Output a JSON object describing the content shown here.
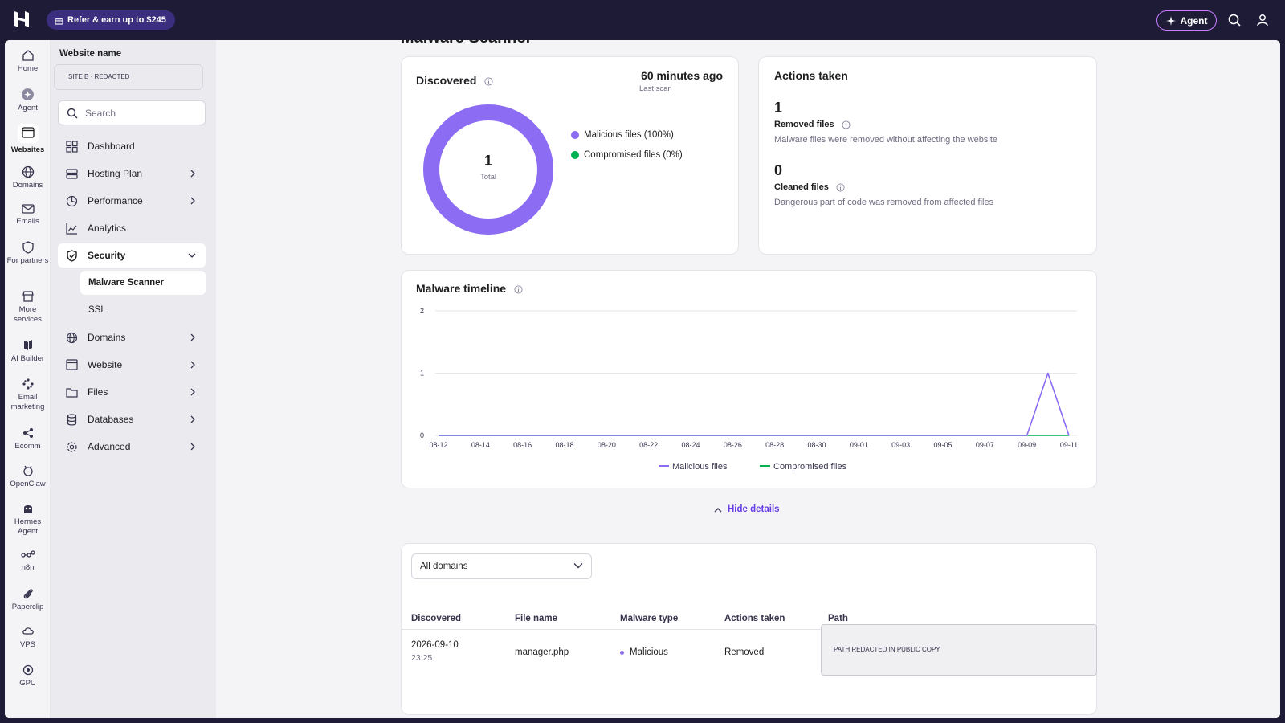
{
  "topbar": {
    "refer_label": "Refer & earn up to $245",
    "agent_label": "Agent",
    "accent": "#673de6"
  },
  "rail": {
    "items": [
      {
        "label": "Home",
        "icon": "home-icon"
      },
      {
        "label": "Agent",
        "icon": "agent-icon"
      },
      {
        "label": "Websites",
        "icon": "websites-icon"
      },
      {
        "label": "Domains",
        "icon": "globe-icon"
      },
      {
        "label": "Emails",
        "icon": "mail-icon"
      },
      {
        "label": "For partners",
        "icon": "shield-icon"
      },
      {
        "label": "More services",
        "icon": "store-icon"
      },
      {
        "label": "AI Builder",
        "icon": "ai-builder-icon"
      },
      {
        "label": "Email marketing",
        "icon": "email-marketing-icon"
      },
      {
        "label": "Ecomm",
        "icon": "ecomm-icon"
      },
      {
        "label": "OpenClaw",
        "icon": "openclaw-icon"
      },
      {
        "label": "Hermes Agent",
        "icon": "hermes-icon"
      },
      {
        "label": "n8n",
        "icon": "n8n-icon"
      },
      {
        "label": "Paperclip",
        "icon": "paperclip-icon"
      },
      {
        "label": "VPS",
        "icon": "vps-icon"
      },
      {
        "label": "GPU",
        "icon": "gpu-icon"
      }
    ]
  },
  "sidebar": {
    "title": "Website name",
    "site": "SITE B · REDACTED",
    "search_placeholder": "Search",
    "items": [
      {
        "label": "Dashboard"
      },
      {
        "label": "Hosting Plan"
      },
      {
        "label": "Performance"
      },
      {
        "label": "Analytics"
      },
      {
        "label": "Security"
      },
      {
        "label": "Domains"
      },
      {
        "label": "Website"
      },
      {
        "label": "Files"
      },
      {
        "label": "Databases"
      },
      {
        "label": "Advanced"
      }
    ],
    "security_sub": [
      {
        "label": "Malware Scanner"
      },
      {
        "label": "SSL"
      }
    ]
  },
  "page": {
    "title": "Malware Scanner"
  },
  "discovered": {
    "title": "Discovered",
    "last_scan_time": "60 minutes ago",
    "last_scan_label": "Last scan",
    "total": "1",
    "total_label": "Total",
    "legend": [
      {
        "label": "Malicious files (100%)",
        "color": "#8c6cf2"
      },
      {
        "label": "Compromised files (0%)",
        "color": "#00b14f"
      }
    ]
  },
  "actions": {
    "title": "Actions taken",
    "removed_count": "1",
    "removed_label": "Removed files",
    "removed_desc": "Malware files were removed without affecting the website",
    "cleaned_count": "0",
    "cleaned_label": "Cleaned files",
    "cleaned_desc": "Dangerous part of code was removed from affected files"
  },
  "timeline": {
    "title": "Malware timeline",
    "hide_details": "Hide details"
  },
  "chart_data": {
    "type": "line",
    "title": "Malware timeline",
    "x": [
      "08-12",
      "08-13",
      "08-14",
      "08-15",
      "08-16",
      "08-17",
      "08-18",
      "08-19",
      "08-20",
      "08-21",
      "08-22",
      "08-23",
      "08-24",
      "08-25",
      "08-26",
      "08-27",
      "08-28",
      "08-29",
      "08-30",
      "08-31",
      "09-01",
      "09-02",
      "09-03",
      "09-04",
      "09-05",
      "09-06",
      "09-07",
      "09-08",
      "09-09",
      "09-10",
      "09-11"
    ],
    "tick_labels": [
      "08-12",
      "08-14",
      "08-16",
      "08-18",
      "08-20",
      "08-22",
      "08-24",
      "08-26",
      "08-28",
      "08-30",
      "09-01",
      "09-03",
      "09-05",
      "09-07",
      "09-09",
      "09-11"
    ],
    "ylim": [
      0,
      2
    ],
    "yticks": [
      0,
      1,
      2
    ],
    "grid": true,
    "legend_position": "bottom",
    "series": [
      {
        "name": "Malicious files",
        "color": "#8c6cf2",
        "values": [
          0,
          0,
          0,
          0,
          0,
          0,
          0,
          0,
          0,
          0,
          0,
          0,
          0,
          0,
          0,
          0,
          0,
          0,
          0,
          0,
          0,
          0,
          0,
          0,
          0,
          0,
          0,
          0,
          0,
          1,
          0
        ]
      },
      {
        "name": "Compromised files",
        "color": "#00b14f",
        "values": [
          0,
          0,
          0,
          0,
          0,
          0,
          0,
          0,
          0,
          0,
          0,
          0,
          0,
          0,
          0,
          0,
          0,
          0,
          0,
          0,
          0,
          0,
          0,
          0,
          0,
          0,
          0,
          0,
          0,
          0,
          0
        ]
      }
    ]
  },
  "table": {
    "filter_value": "All domains",
    "headers": [
      "Discovered",
      "File name",
      "Malware type",
      "Actions taken",
      "Path"
    ],
    "rows": [
      {
        "date": "2026-09-10",
        "time": "23:25",
        "file": "manager.php",
        "type": "Malicious",
        "action": "Removed",
        "path": "PATH REDACTED IN PUBLIC COPY"
      }
    ]
  }
}
